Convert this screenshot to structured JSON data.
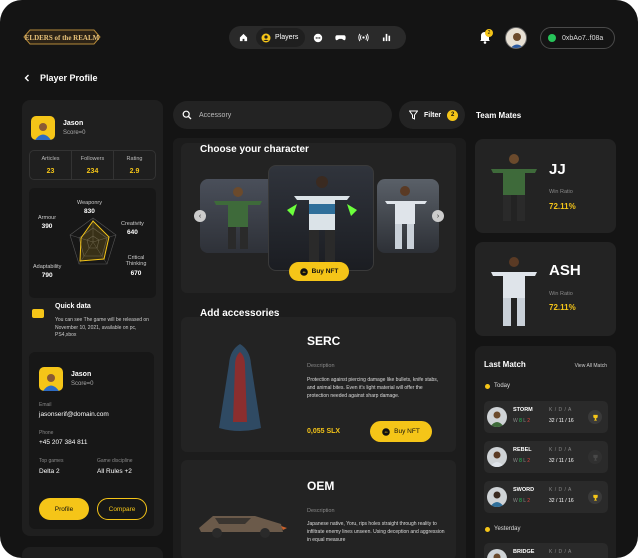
{
  "header": {
    "logo_text": "ELDERS OF THE REALM",
    "nav": [
      {
        "name": "home-icon"
      },
      {
        "label": "Players",
        "name": "user-circle-icon"
      },
      {
        "name": "chat-icon"
      },
      {
        "name": "gamepad-icon"
      },
      {
        "name": "broadcast-icon"
      },
      {
        "name": "bar-chart-icon"
      }
    ],
    "notification_count": "2",
    "wallet_address": "0xbAo7..f08a"
  },
  "page": {
    "title": "Player Profile",
    "back_icon": "chevron-left-icon"
  },
  "profile": {
    "name": "Jason",
    "score": "Score=0",
    "stats": [
      {
        "label": "Articles",
        "value": "23"
      },
      {
        "label": "Followers",
        "value": "234"
      },
      {
        "label": "Rating",
        "value": "2.9"
      }
    ],
    "attributes": [
      {
        "label": "Weaponry",
        "value": "830"
      },
      {
        "label": "Creativity",
        "value": "640"
      },
      {
        "label": "Critical Thinking",
        "value": "670"
      },
      {
        "label": "Adaptability",
        "value": "790"
      },
      {
        "label": "Armour",
        "value": "390"
      }
    ],
    "quick_data": {
      "title": "Quick data",
      "text": "You can see The game will be released on November 10, 2021, available on pc, PS4,xbox"
    }
  },
  "profile_card": {
    "name": "Jason",
    "score": "Score=0",
    "email_label": "Email",
    "email": "jasonserif@domain.com",
    "phone_label": "Phone",
    "phone": "+45 207 384 811",
    "top_games_label": "Top games",
    "top_games": "Delta 2",
    "game_discipline_label": "Game discipline",
    "game_discipline": "All Rules +2",
    "profile_button": "Profile",
    "compare_button": "Compare"
  },
  "search": {
    "placeholder": "Accessory",
    "filter_label": "Filter",
    "filter_count": "2"
  },
  "choose": {
    "title": "Choose your character",
    "buy_label": "Buy NFT"
  },
  "accessories": {
    "title": "Add accessories",
    "items": [
      {
        "name": "SERC",
        "description_label": "Description",
        "description": "Protection against piercing damage like bullets, knife stabs, and animal bites. Even it's light material will offer the protection needed against sharp damage.",
        "price": "0,055 SLX",
        "buy_label": "Buy NFT"
      },
      {
        "name": "OEM",
        "description_label": "Description",
        "description": "Japanese native, Yoru, rips holes straight through reality to infiltrate enemy lines unseen. Using deception and aggression in equal measure"
      }
    ]
  },
  "team_mates": {
    "title": "Team Mates",
    "mates": [
      {
        "name": "JJ",
        "win_label": "Win Ratio",
        "win_value": "72.11%"
      },
      {
        "name": "ASH",
        "win_label": "Win Ratio",
        "win_value": "72.11%"
      }
    ]
  },
  "last_match": {
    "title": "Last Match",
    "view_all": "View All Match",
    "today_label": "Today",
    "yesterday_label": "Yesterday",
    "matches": [
      {
        "name": "STORM",
        "w": "8",
        "l": "2",
        "kda_label": "K / D / A",
        "kda": "32 / 11 / 16",
        "trophy": true
      },
      {
        "name": "REBEL",
        "w": "8",
        "l": "2",
        "kda_label": "K / D / A",
        "kda": "32 / 11 / 16",
        "trophy": false
      },
      {
        "name": "SWORD",
        "w": "8",
        "l": "2",
        "kda_label": "K / D / A",
        "kda": "32 / 11 / 16",
        "trophy": true
      },
      {
        "name": "BRIDGE",
        "w": "",
        "l": "",
        "kda_label": "K / D / A",
        "kda": ""
      }
    ]
  },
  "colors": {
    "accent": "#f5c518",
    "background": "#141414",
    "panel": "#1f1f1f",
    "win": "#27c45a",
    "loss": "#e0433a"
  }
}
